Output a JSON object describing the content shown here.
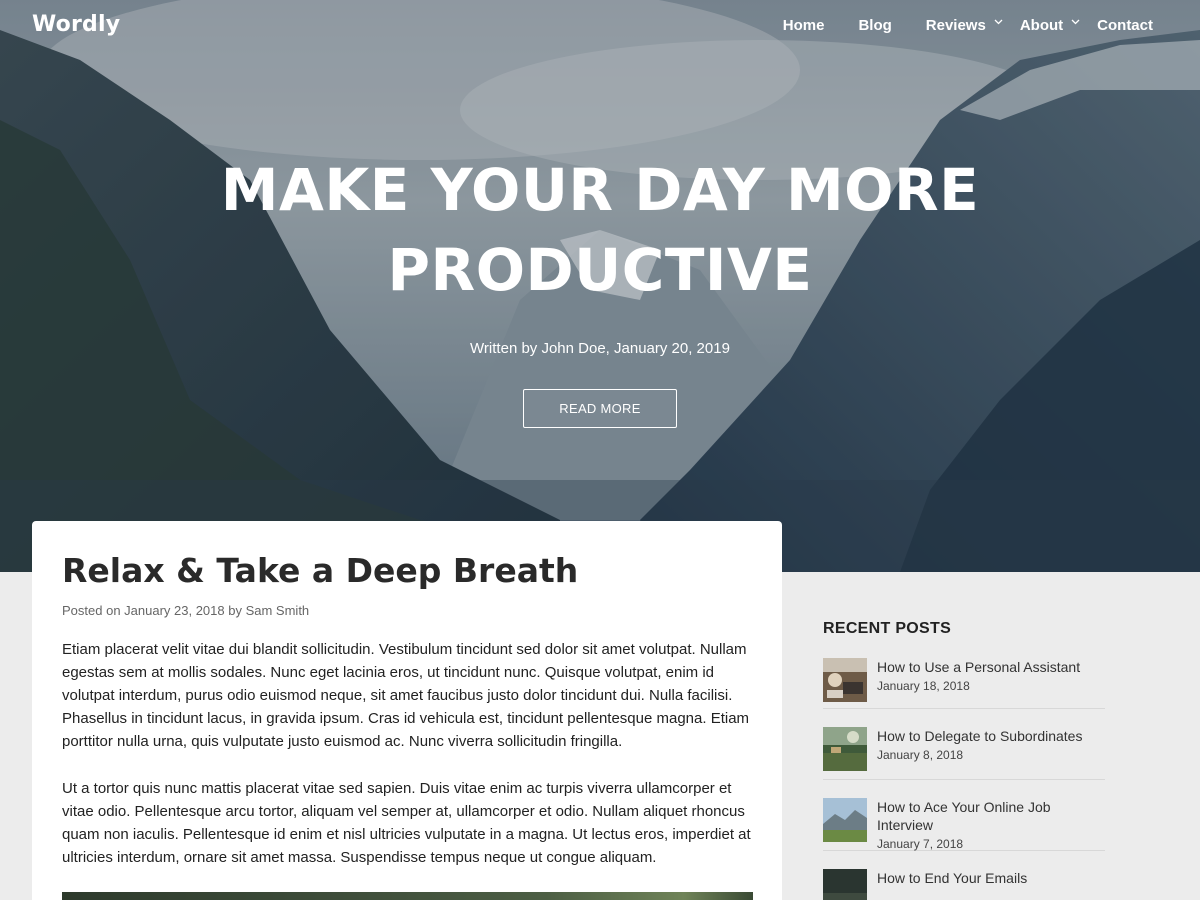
{
  "header": {
    "logo": "Wordly",
    "nav": [
      {
        "label": "Home",
        "has_submenu": false
      },
      {
        "label": "Blog",
        "has_submenu": false
      },
      {
        "label": "Reviews",
        "has_submenu": true
      },
      {
        "label": "About",
        "has_submenu": true
      },
      {
        "label": "Contact",
        "has_submenu": false
      }
    ]
  },
  "hero": {
    "title_line1": "MAKE YOUR DAY MORE",
    "title_line2": "PRODUCTIVE",
    "byline": "Written by John Doe, January 20, 2019",
    "button_label": "READ MORE"
  },
  "post": {
    "title": "Relax & Take a Deep Breath",
    "meta_prefix": "Posted on ",
    "date": "January 23, 2018",
    "meta_by": " by ",
    "author": "Sam Smith",
    "paragraphs": [
      "Etiam placerat velit vitae dui blandit sollicitudin. Vestibulum tincidunt sed dolor sit amet volutpat. Nullam egestas sem at mollis sodales. Nunc eget lacinia eros, ut tincidunt nunc. Quisque volutpat, enim id volutpat interdum, purus odio euismod neque, sit amet faucibus justo dolor tincidunt dui. Nulla facilisi. Phasellus in tincidunt lacus, in gravida ipsum. Cras id vehicula est, tincidunt pellentesque magna. Etiam porttitor nulla urna, quis vulputate justo euismod ac. Nunc viverra sollicitudin fringilla.",
      "Ut a tortor quis nunc mattis placerat vitae sed sapien. Duis vitae enim ac turpis viverra ullamcorper et vitae odio. Pellentesque arcu tortor, aliquam vel semper at, ullamcorper et odio. Nullam aliquet rhoncus quam non iaculis. Pellentesque id enim et nisl ultricies vulputate in a magna. Ut lectus eros, imperdiet at ultricies interdum, ornare sit amet massa. Suspendisse tempus neque ut congue aliquam."
    ]
  },
  "sidebar": {
    "title": "RECENT POSTS",
    "posts": [
      {
        "title": "How to Use a Personal Assistant",
        "date": "January 18, 2018"
      },
      {
        "title": "How to Delegate to Subordinates",
        "date": "January 8, 2018"
      },
      {
        "title": "How to Ace Your Online Job Interview",
        "date": "January 7, 2018"
      },
      {
        "title": "How to End Your Emails",
        "date": ""
      }
    ]
  }
}
